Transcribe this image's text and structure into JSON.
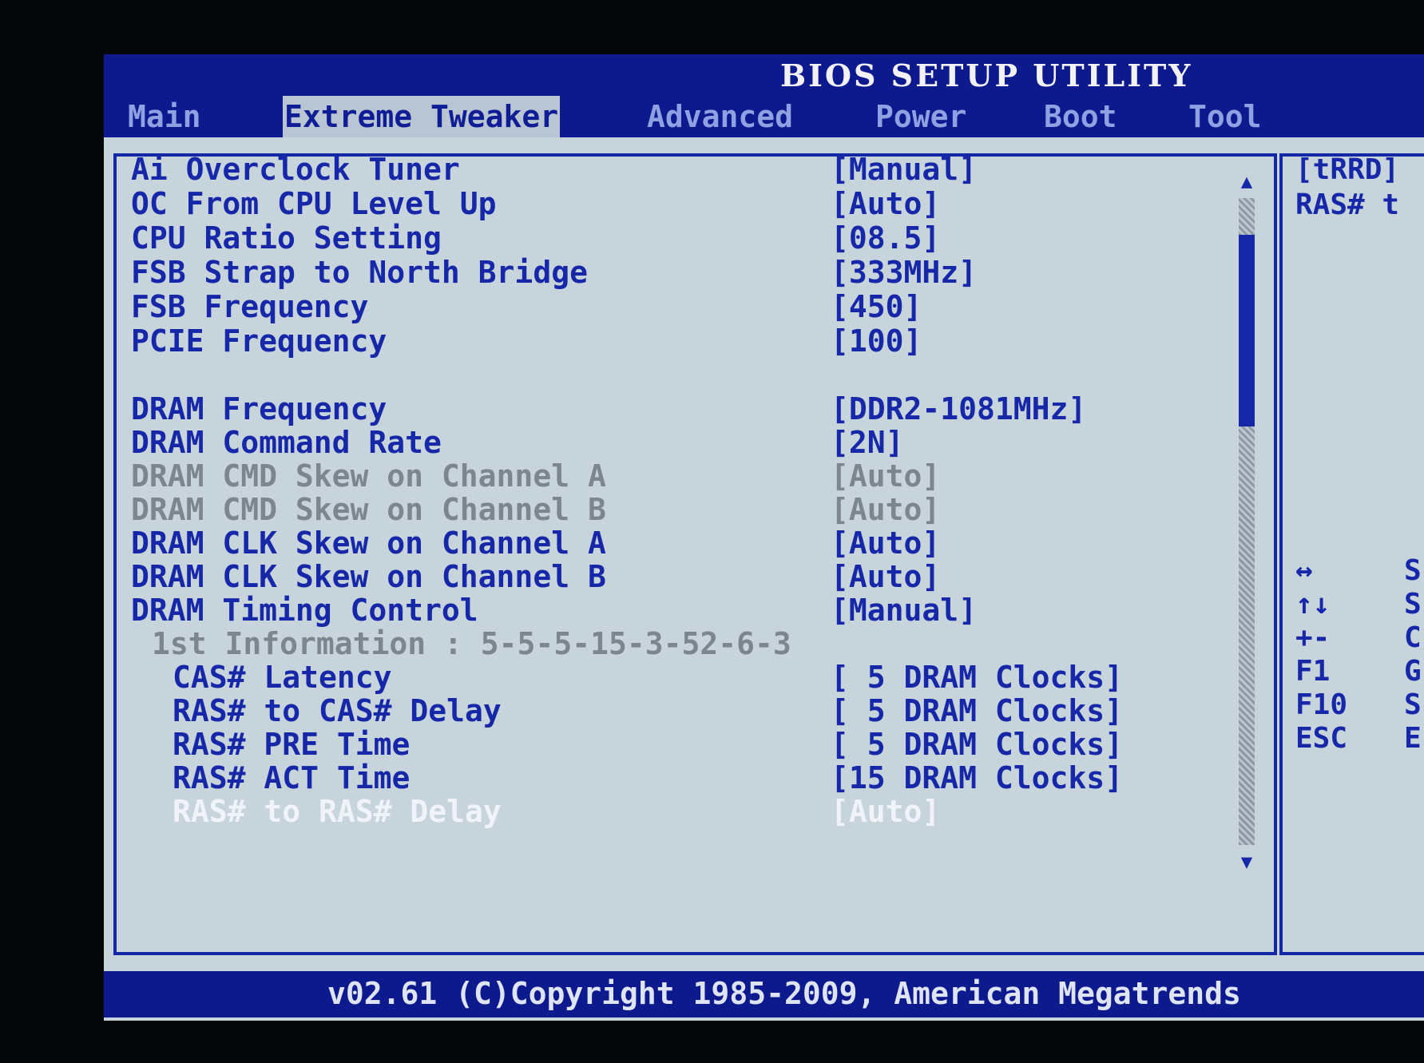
{
  "title": "BIOS SETUP UTILITY",
  "tabs": [
    {
      "label": "Main"
    },
    {
      "label": "Extreme Tweaker"
    },
    {
      "label": "Advanced"
    },
    {
      "label": "Power"
    },
    {
      "label": "Boot"
    },
    {
      "label": "Tool"
    }
  ],
  "items": [
    {
      "label": "Ai Overclock Tuner",
      "value": "[Manual]"
    },
    {
      "label": "OC From CPU Level Up",
      "value": "[Auto]"
    },
    {
      "label": "CPU Ratio Setting",
      "value": "[08.5]"
    },
    {
      "label": "FSB Strap to North Bridge",
      "value": "[333MHz]"
    },
    {
      "label": "FSB Frequency",
      "value": "[450]"
    },
    {
      "label": "PCIE Frequency",
      "value": "[100]"
    },
    {
      "label": "DRAM Frequency",
      "value": "[DDR2-1081MHz]"
    },
    {
      "label": "DRAM Command Rate",
      "value": "[2N]"
    },
    {
      "label": "DRAM CMD Skew on Channel A",
      "value": "[Auto]"
    },
    {
      "label": "DRAM CMD Skew on Channel B",
      "value": "[Auto]"
    },
    {
      "label": "DRAM CLK Skew on Channel A",
      "value": "[Auto]"
    },
    {
      "label": "DRAM CLK Skew on Channel B",
      "value": "[Auto]"
    },
    {
      "label": "DRAM Timing Control",
      "value": "[Manual]"
    },
    {
      "label": "1st Information : 5-5-5-15-3-52-6-3"
    },
    {
      "label": "CAS# Latency",
      "value": "[ 5 DRAM Clocks]"
    },
    {
      "label": "RAS# to CAS# Delay",
      "value": "[ 5 DRAM Clocks]"
    },
    {
      "label": "RAS# PRE Time",
      "value": "[ 5 DRAM Clocks]"
    },
    {
      "label": "RAS# ACT Time",
      "value": "[15 DRAM Clocks]"
    },
    {
      "label": "RAS# to RAS# Delay",
      "value": "[Auto]"
    }
  ],
  "help": {
    "line1": "[tRRD]",
    "line2": "RAS# t"
  },
  "keys": [
    {
      "key": "↔",
      "desc": "S"
    },
    {
      "key": "↑↓",
      "desc": "S"
    },
    {
      "key": "+-",
      "desc": "C"
    },
    {
      "key": "F1",
      "desc": "G"
    },
    {
      "key": "F10",
      "desc": "S"
    },
    {
      "key": "ESC",
      "desc": "E"
    }
  ],
  "footer": "v02.61 (C)Copyright 1985-2009, American Megatrends",
  "colors": {
    "bar": "#0c1a8e",
    "panel": "#c8d4dc",
    "item_active": "#1628a8",
    "item_disabled": "#7c8690",
    "item_selected": "#f0f4fa"
  }
}
